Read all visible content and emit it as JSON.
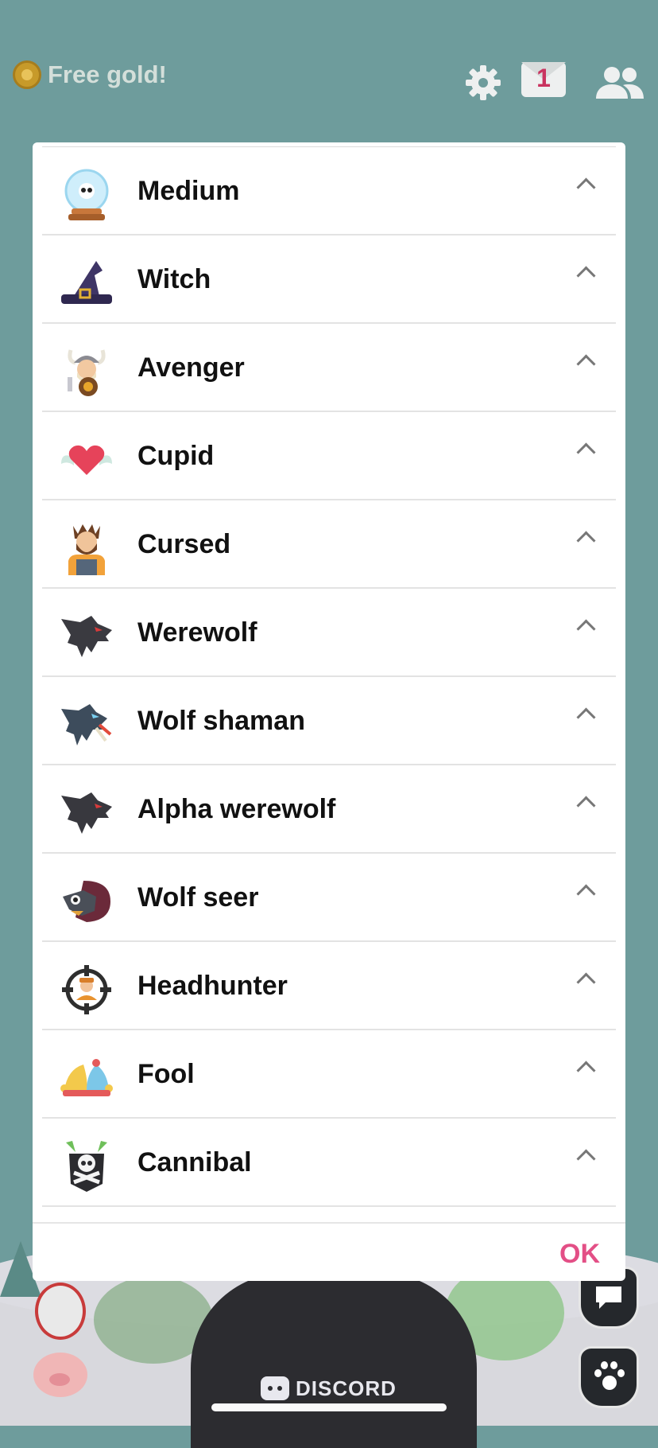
{
  "top_bar": {
    "gold_label": "Free gold!",
    "mail_count": "1"
  },
  "dialog": {
    "roles": [
      {
        "name": "Medium",
        "icon": "crystal-ball-icon"
      },
      {
        "name": "Witch",
        "icon": "witch-hat-icon"
      },
      {
        "name": "Avenger",
        "icon": "viking-icon"
      },
      {
        "name": "Cupid",
        "icon": "winged-heart-icon"
      },
      {
        "name": "Cursed",
        "icon": "cursed-villager-icon"
      },
      {
        "name": "Werewolf",
        "icon": "werewolf-icon"
      },
      {
        "name": "Wolf shaman",
        "icon": "wolf-shaman-icon"
      },
      {
        "name": "Alpha werewolf",
        "icon": "alpha-werewolf-icon"
      },
      {
        "name": "Wolf seer",
        "icon": "wolf-seer-icon"
      },
      {
        "name": "Headhunter",
        "icon": "crosshair-icon"
      },
      {
        "name": "Fool",
        "icon": "jester-hat-icon"
      },
      {
        "name": "Cannibal",
        "icon": "cannibal-skull-icon"
      }
    ],
    "ok_label": "OK"
  },
  "background": {
    "badge_label": "DISCORD"
  },
  "colors": {
    "background": "#6e9c9c",
    "ok": "#e34f86",
    "mail_badge": "#c9335f"
  }
}
